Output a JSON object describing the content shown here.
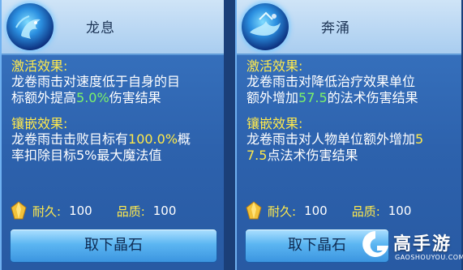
{
  "cards": [
    {
      "title": "龙息",
      "activation_title": "激活效果:",
      "activation_lines": [
        {
          "pre": "龙卷雨击对速度低于自身的目",
          "hl": "",
          "post": ""
        },
        {
          "pre": "标额外提高",
          "hl": "5.0%",
          "post": "伤害结果"
        }
      ],
      "inlay_title": "镶嵌效果:",
      "inlay_lines": [
        {
          "pre": "龙卷雨击击败目标有",
          "hl": "100.0%",
          "post": "概"
        },
        {
          "pre": "率扣除目标5%最大魔法值",
          "hl": "",
          "post": ""
        }
      ],
      "durability_label": "耐久:",
      "durability_value": "100",
      "quality_label": "品质:",
      "quality_value": "100",
      "button_label": "取下晶石"
    },
    {
      "title": "奔涌",
      "activation_title": "激活效果:",
      "activation_lines": [
        {
          "pre": "龙卷雨击对降低治疗效果单位",
          "hl": "",
          "post": ""
        },
        {
          "pre": "额外增加",
          "hl": "57.5",
          "post": "的法术伤害结果"
        }
      ],
      "inlay_title": "镶嵌效果:",
      "inlay_lines": [
        {
          "pre": "龙卷雨击对人物单位额外增加",
          "hl": "5",
          "post": ""
        },
        {
          "pre": "",
          "hl": "7.5",
          "post": "点法术伤害结果"
        }
      ],
      "durability_label": "耐久:",
      "durability_value": "100",
      "quality_label": "品质:",
      "quality_value": "100",
      "button_label": "取下晶石"
    }
  ],
  "watermark": {
    "main": "高手游",
    "sub": "GAOSHOUYOU.COM"
  },
  "icons": [
    "dragon-emblem-icon",
    "wave-emblem-icon",
    "gold-crystal-icon",
    "gaoshouyou-logo-icon"
  ],
  "colors": {
    "section_title": "#ffea4d",
    "highlight_green": "#7cf36a",
    "highlight_yellow": "#ffe94a",
    "text": "#ffffff"
  }
}
